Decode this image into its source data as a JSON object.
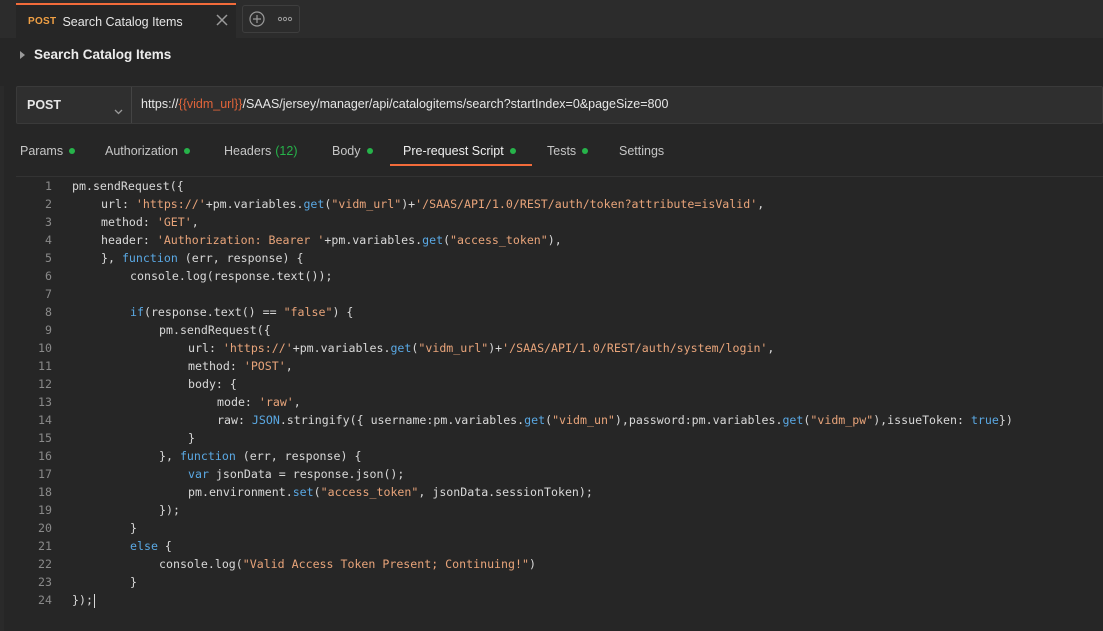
{
  "tab": {
    "method": "POST",
    "title": "Search Catalog Items"
  },
  "request": {
    "title": "Search Catalog Items",
    "method": "POST",
    "url_prefix": "https://",
    "url_var": "{{vidm_url}}",
    "url_suffix": "/SAAS/jersey/manager/api/catalogitems/search?startIndex=0&pageSize=800"
  },
  "subtabs": [
    {
      "label": "Params",
      "dot": true
    },
    {
      "label": "Authorization",
      "dot": true
    },
    {
      "label": "Headers",
      "count": "(12)"
    },
    {
      "label": "Body",
      "dot": true
    },
    {
      "label": "Pre-request Script",
      "dot": true,
      "active": true
    },
    {
      "label": "Tests",
      "dot": true
    },
    {
      "label": "Settings"
    }
  ],
  "icons": {
    "close": "close-icon",
    "add": "plus-circle-icon",
    "more": "more-icon",
    "chevron": "chevron-down-icon",
    "caret": "caret-right-icon"
  },
  "colors": {
    "accent": "#f26b3a",
    "dot": "#26b34a",
    "method_tab": "#f0a044"
  },
  "code": [
    [
      [
        "pm.sendRequest({",
        ""
      ]
    ],
    [
      [
        "url: ",
        ""
      ],
      [
        "'https://'",
        "s"
      ],
      [
        "+pm.variables.",
        ""
      ],
      [
        "get",
        "f"
      ],
      [
        "(",
        ""
      ],
      [
        "\"vidm_url\"",
        "d"
      ],
      [
        ")+",
        ""
      ],
      [
        "'/SAAS/API/1.0/REST/auth/token?attribute=isValid'",
        "s"
      ],
      [
        ",",
        ""
      ]
    ],
    [
      [
        "method: ",
        ""
      ],
      [
        "'GET'",
        "s"
      ],
      [
        ",",
        ""
      ]
    ],
    [
      [
        "header: ",
        ""
      ],
      [
        "'Authorization: Bearer '",
        "s"
      ],
      [
        "+pm.variables.",
        ""
      ],
      [
        "get",
        "f"
      ],
      [
        "(",
        ""
      ],
      [
        "\"access_token\"",
        "d"
      ],
      [
        "),",
        ""
      ]
    ],
    [
      [
        "}, ",
        ""
      ],
      [
        "function",
        "k"
      ],
      [
        " (err, response) {",
        ""
      ]
    ],
    [
      [
        "console.log(response.text());",
        ""
      ]
    ],
    [],
    [
      [
        "if",
        "k"
      ],
      [
        "(response.text() == ",
        ""
      ],
      [
        "\"false\"",
        "d"
      ],
      [
        ") {",
        ""
      ]
    ],
    [
      [
        "pm.sendRequest({",
        ""
      ]
    ],
    [
      [
        "url: ",
        ""
      ],
      [
        "'https://'",
        "s"
      ],
      [
        "+pm.variables.",
        ""
      ],
      [
        "get",
        "f"
      ],
      [
        "(",
        ""
      ],
      [
        "\"vidm_url\"",
        "d"
      ],
      [
        ")+",
        ""
      ],
      [
        "'/SAAS/API/1.0/REST/auth/system/login'",
        "s"
      ],
      [
        ",",
        ""
      ]
    ],
    [
      [
        "method: ",
        ""
      ],
      [
        "'POST'",
        "s"
      ],
      [
        ",",
        ""
      ]
    ],
    [
      [
        "body: {",
        ""
      ]
    ],
    [
      [
        "mode: ",
        ""
      ],
      [
        "'raw'",
        "s"
      ],
      [
        ",",
        ""
      ]
    ],
    [
      [
        "raw: ",
        ""
      ],
      [
        "JSON",
        "b"
      ],
      [
        ".stringify({ username:pm.variables.",
        ""
      ],
      [
        "get",
        "f"
      ],
      [
        "(",
        ""
      ],
      [
        "\"vidm_un\"",
        "d"
      ],
      [
        "),password:pm.variables.",
        ""
      ],
      [
        "get",
        "f"
      ],
      [
        "(",
        ""
      ],
      [
        "\"vidm_pw\"",
        "d"
      ],
      [
        "),issueToken: ",
        ""
      ],
      [
        "true",
        "b"
      ],
      [
        "})",
        ""
      ]
    ],
    [
      [
        "}",
        ""
      ]
    ],
    [
      [
        "}, ",
        ""
      ],
      [
        "function",
        "k"
      ],
      [
        " (err, response) {",
        ""
      ]
    ],
    [
      [
        "var",
        "k"
      ],
      [
        " jsonData = response.json();",
        ""
      ]
    ],
    [
      [
        "pm.environment.",
        ""
      ],
      [
        "set",
        "f"
      ],
      [
        "(",
        ""
      ],
      [
        "\"access_token\"",
        "d"
      ],
      [
        ", jsonData.sessionToken);",
        ""
      ]
    ],
    [
      [
        "});",
        ""
      ]
    ],
    [
      [
        "}",
        ""
      ]
    ],
    [
      [
        "else",
        "k"
      ],
      [
        " {",
        ""
      ]
    ],
    [
      [
        "console.log(",
        ""
      ],
      [
        "\"Valid Access Token Present; Continuing!\"",
        "d"
      ],
      [
        ")",
        ""
      ]
    ],
    [
      [
        "}",
        ""
      ]
    ],
    [
      [
        "});",
        ""
      ]
    ]
  ],
  "indent": [
    0,
    1,
    1,
    1,
    1,
    2,
    0,
    2,
    3,
    4,
    4,
    4,
    5,
    5,
    4,
    3,
    4,
    4,
    3,
    2,
    2,
    3,
    2,
    0
  ]
}
